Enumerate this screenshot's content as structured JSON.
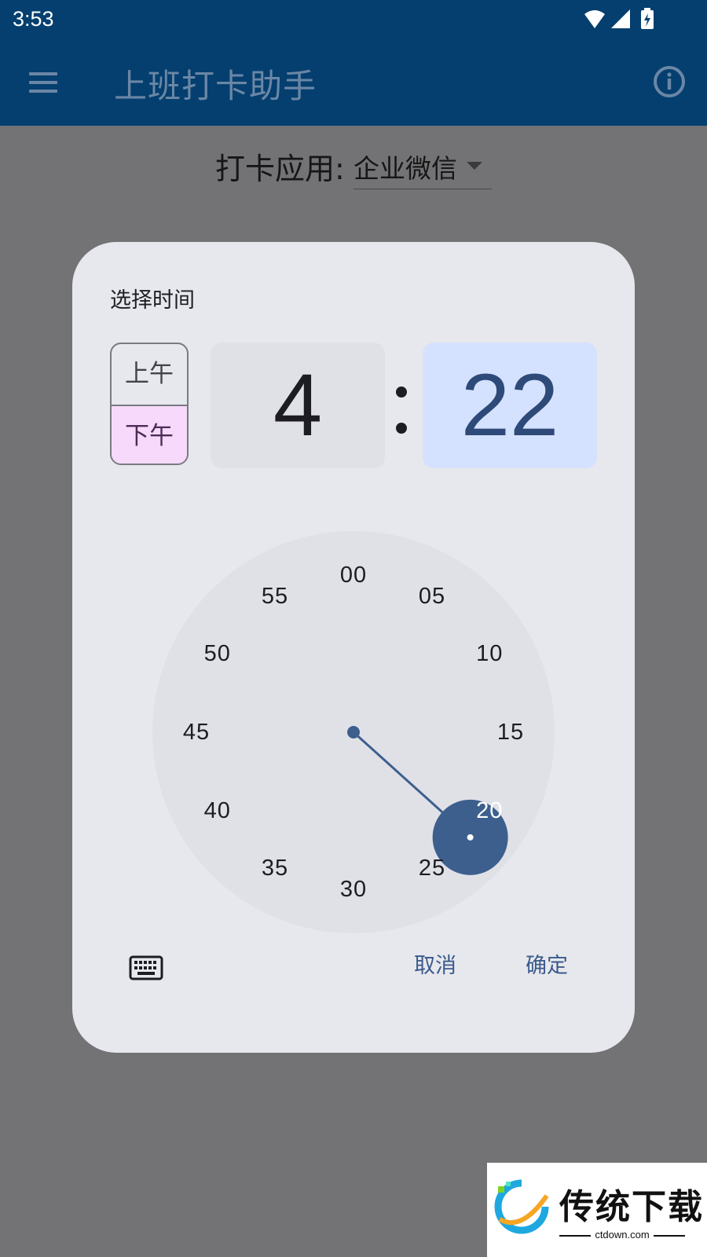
{
  "status_bar": {
    "time": "3:53"
  },
  "app_bar": {
    "title": "上班打卡助手"
  },
  "clock_app_picker": {
    "label": "打卡应用:",
    "selected": "企业微信"
  },
  "time_dialog": {
    "title": "选择时间",
    "period_options": {
      "am": "上午",
      "pm": "下午",
      "selected": "pm"
    },
    "hour": "4",
    "minute": "22",
    "dial_labels": [
      "00",
      "05",
      "10",
      "15",
      "20",
      "25",
      "30",
      "35",
      "40",
      "45",
      "50",
      "55"
    ],
    "selected_minute": 22,
    "cancel_label": "取消",
    "ok_label": "确定"
  },
  "watermark": {
    "title": "传统下载",
    "subtitle": "ctdown.com"
  },
  "colors": {
    "app_bar": "#043f6f",
    "dialog_bg": "#e7e8ed",
    "accent": "#3c5f8e",
    "pm_selected": "#f6d9fb",
    "minute_box": "#d5e2ff"
  }
}
